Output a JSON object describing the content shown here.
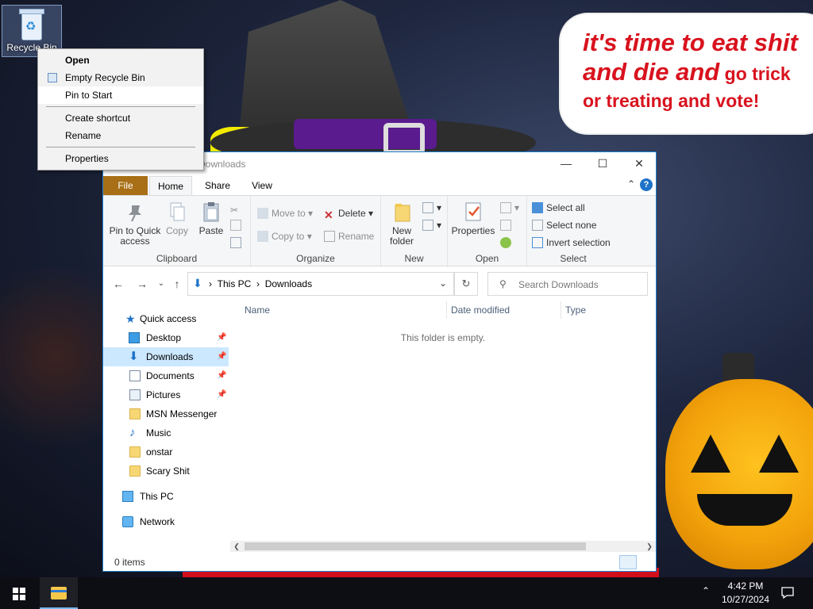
{
  "desktop": {
    "recycle_bin_label": "Recycle Bin",
    "wallpaper_text_line1": "it's time to eat shit",
    "wallpaper_text_line2a": "and die and",
    "wallpaper_text_line2b": "go trick",
    "wallpaper_text_line3": "or treating and vote!"
  },
  "context_menu": {
    "items": [
      {
        "label": "Open",
        "bold": true
      },
      {
        "label": "Empty Recycle Bin",
        "icon": "recycle-bin-icon"
      },
      {
        "label": "Pin to Start",
        "hover": true
      },
      {
        "separator": true
      },
      {
        "label": "Create shortcut"
      },
      {
        "label": "Rename"
      },
      {
        "separator": true
      },
      {
        "label": "Properties"
      }
    ]
  },
  "explorer": {
    "title": "Downloads",
    "tabs": [
      {
        "label": "File"
      },
      {
        "label": "Home",
        "active": true
      },
      {
        "label": "Share"
      },
      {
        "label": "View"
      }
    ],
    "ribbon": {
      "clipboard": {
        "label": "Clipboard",
        "pin": "Pin to Quick access",
        "copy": "Copy",
        "paste": "Paste"
      },
      "organize": {
        "label": "Organize",
        "move_to": "Move to",
        "copy_to": "Copy to",
        "delete": "Delete",
        "rename": "Rename"
      },
      "new": {
        "label": "New",
        "new_folder": "New folder"
      },
      "open": {
        "label": "Open",
        "properties": "Properties"
      },
      "select": {
        "label": "Select",
        "select_all": "Select all",
        "select_none": "Select none",
        "invert": "Invert selection"
      }
    },
    "address": {
      "crumb1": "This PC",
      "crumb2": "Downloads",
      "search_placeholder": "Search Downloads"
    },
    "nav": {
      "quick_access": "Quick access",
      "items": [
        {
          "label": "Desktop",
          "pinned": true,
          "icon": "desktop-icon"
        },
        {
          "label": "Downloads",
          "pinned": true,
          "icon": "downloads-icon",
          "selected": true
        },
        {
          "label": "Documents",
          "pinned": true,
          "icon": "documents-icon"
        },
        {
          "label": "Pictures",
          "pinned": true,
          "icon": "pictures-icon"
        },
        {
          "label": "MSN Messenger",
          "icon": "folder-icon"
        },
        {
          "label": "Music",
          "icon": "music-icon"
        },
        {
          "label": "onstar",
          "icon": "folder-icon"
        },
        {
          "label": "Scary Shit",
          "icon": "folder-icon"
        }
      ],
      "this_pc": "This PC",
      "network": "Network"
    },
    "columns": {
      "name": "Name",
      "date_modified": "Date modified",
      "type": "Type"
    },
    "empty_message": "This folder is empty.",
    "status": "0 items"
  },
  "taskbar": {
    "time": "4:42 PM",
    "date": "10/27/2024"
  },
  "colors": {
    "accent": "#1e73c8",
    "file_tab": "#a86f16",
    "selected": "#cce8ff",
    "taskbar": "#0d0d14"
  }
}
